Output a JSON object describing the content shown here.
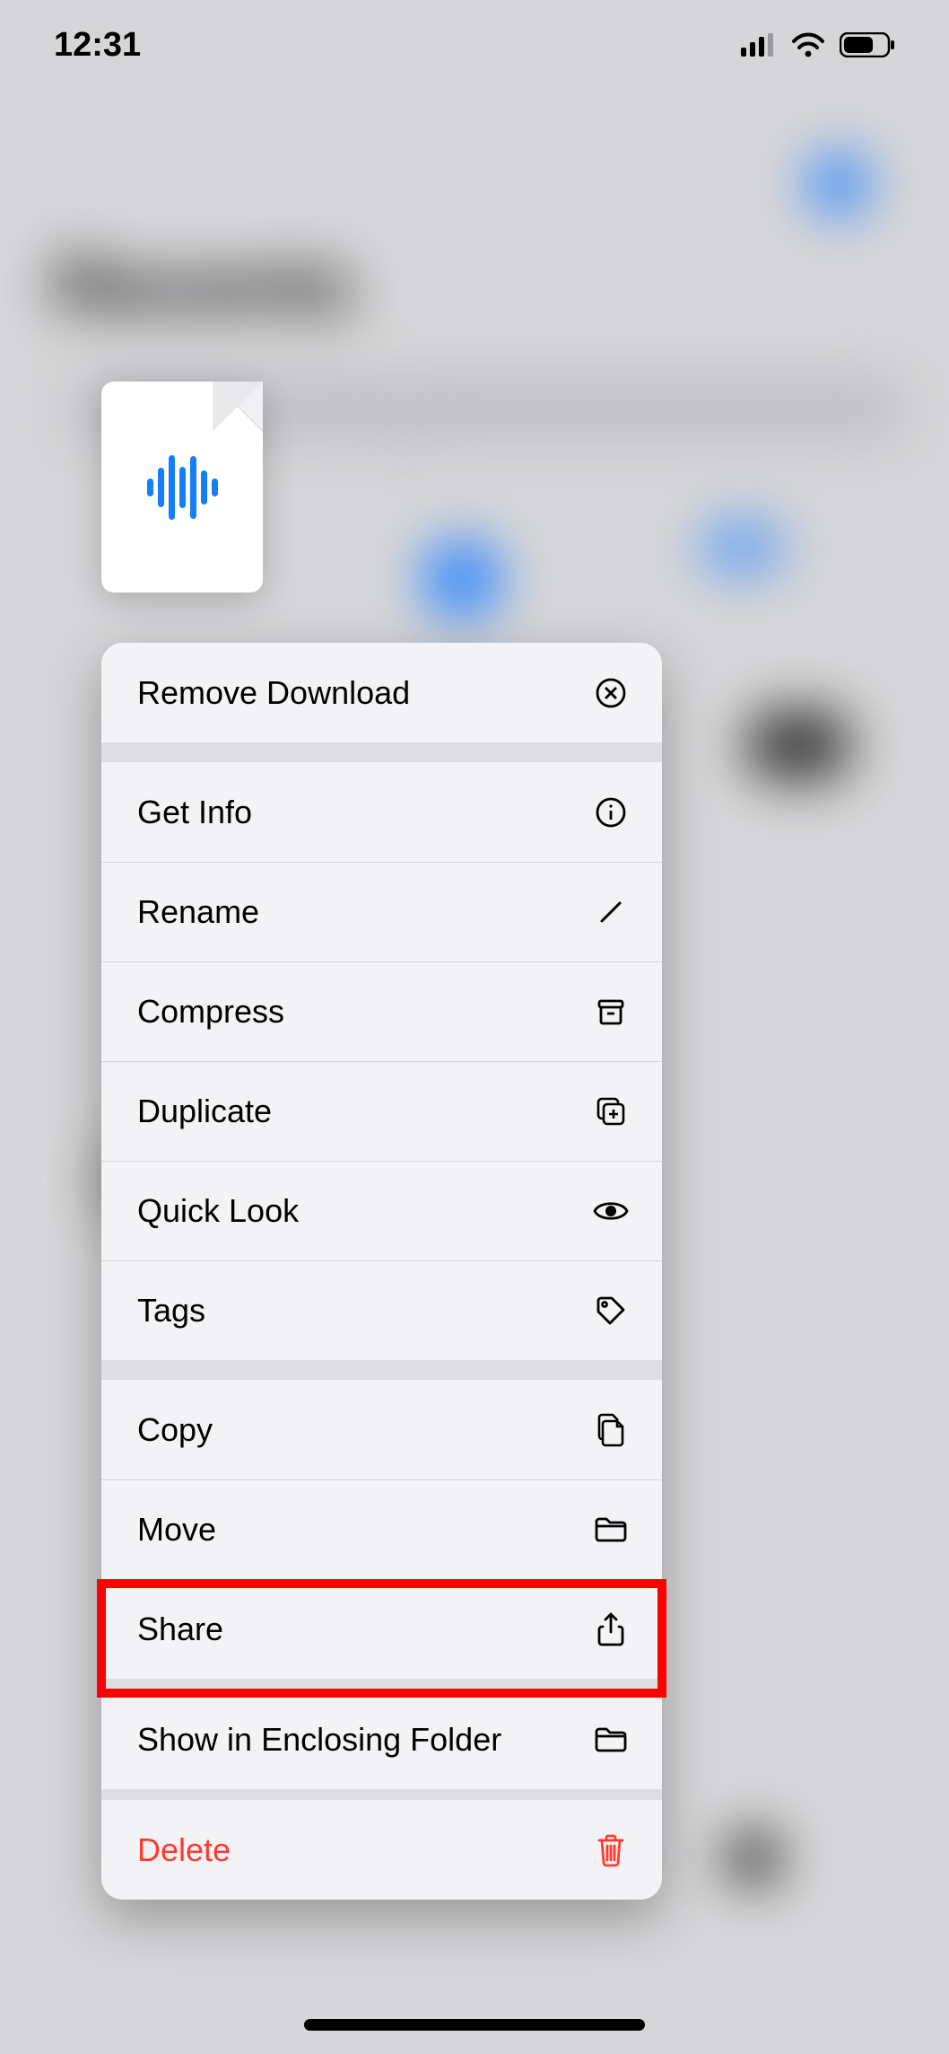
{
  "status": {
    "time": "12:31"
  },
  "background": {
    "page_title": "Recents"
  },
  "file": {
    "icon": "audio-waveform-icon"
  },
  "menu": {
    "groups": [
      {
        "items": [
          {
            "label": "Remove Download",
            "icon": "x-circle-icon",
            "danger": false
          }
        ]
      },
      {
        "items": [
          {
            "label": "Get Info",
            "icon": "info-circle-icon",
            "danger": false
          },
          {
            "label": "Rename",
            "icon": "pencil-icon",
            "danger": false
          },
          {
            "label": "Compress",
            "icon": "archivebox-icon",
            "danger": false
          },
          {
            "label": "Duplicate",
            "icon": "plus-square-on-square-icon",
            "danger": false
          },
          {
            "label": "Quick Look",
            "icon": "eye-icon",
            "danger": false
          },
          {
            "label": "Tags",
            "icon": "tag-icon",
            "danger": false
          }
        ]
      },
      {
        "items": [
          {
            "label": "Copy",
            "icon": "doc-on-doc-icon",
            "danger": false
          },
          {
            "label": "Move",
            "icon": "folder-icon",
            "danger": false
          },
          {
            "label": "Share",
            "icon": "share-icon",
            "danger": false,
            "highlighted": true
          }
        ]
      },
      {
        "items": [
          {
            "label": "Show in Enclosing Folder",
            "icon": "folder-icon",
            "danger": false
          }
        ]
      },
      {
        "items": [
          {
            "label": "Delete",
            "icon": "trash-icon",
            "danger": true
          }
        ]
      }
    ]
  },
  "highlight": {
    "target_label": "Share"
  }
}
